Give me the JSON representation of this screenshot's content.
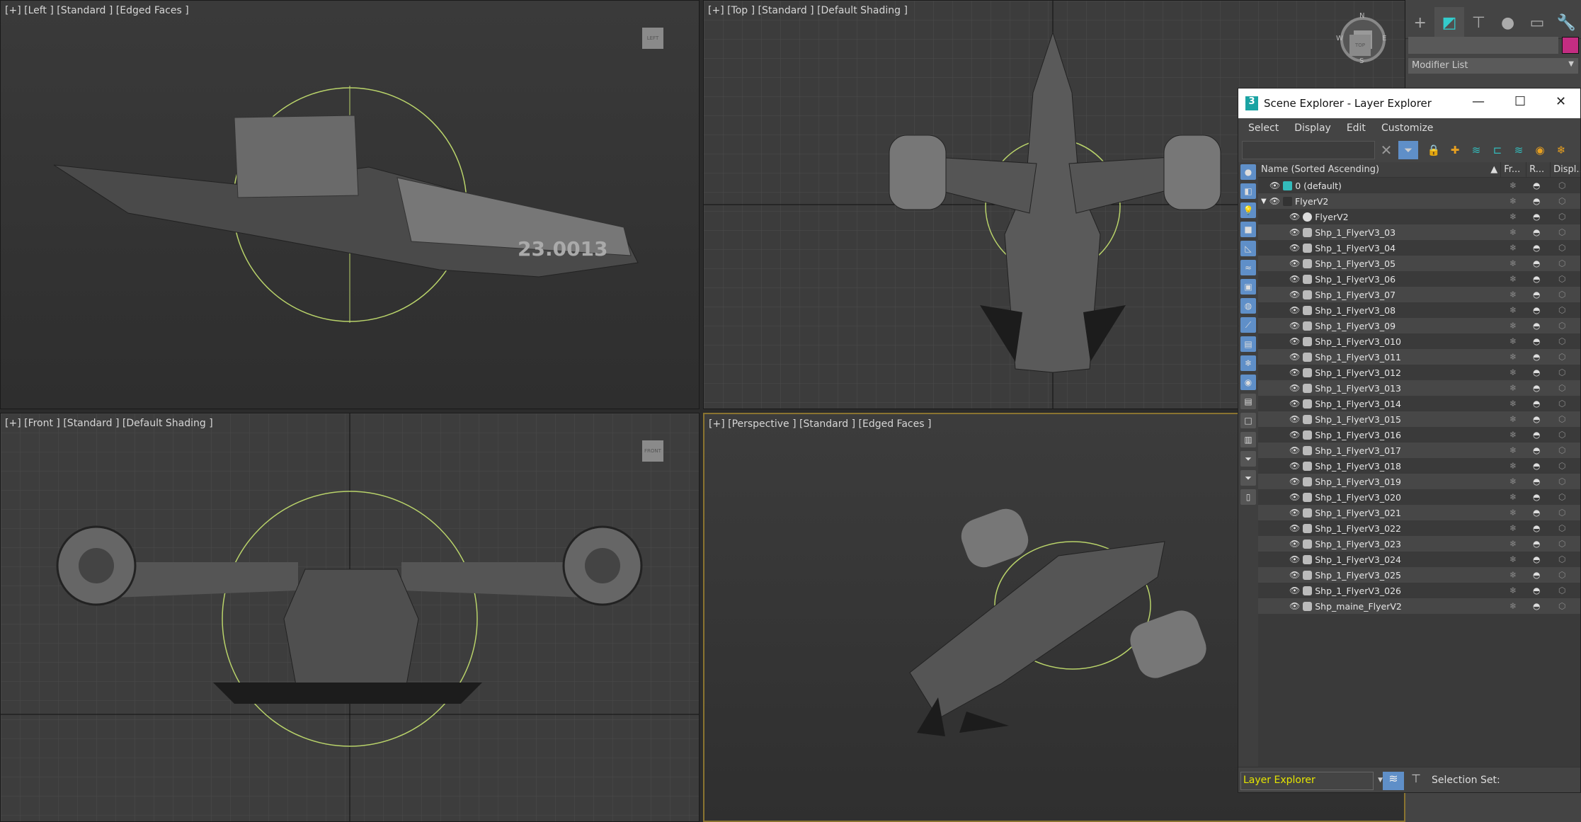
{
  "viewports": {
    "left": {
      "label": "[+] [Left ] [Standard ] [Edged Faces ]",
      "cube": "LEFT"
    },
    "top": {
      "label": "[+] [Top ] [Standard ] [Default Shading ]",
      "cube": "TOP",
      "compass": [
        "N",
        "S",
        "E",
        "W"
      ]
    },
    "front": {
      "label": "[+] [Front ] [Standard ] [Default Shading ]",
      "cube": "FRONT"
    },
    "perspective": {
      "label": "[+] [Perspective ] [Standard ] [Edged Faces ]",
      "active": true
    },
    "ship_decal": "23.0013"
  },
  "command_panel": {
    "tabs": [
      "create",
      "modify",
      "hierarchy",
      "motion",
      "display",
      "utilities"
    ],
    "active_tab": "modify",
    "object_color": "#c42d82",
    "modifier_list": "Modifier List"
  },
  "scene_explorer": {
    "title": "Scene Explorer - Layer Explorer",
    "logo": "3",
    "menu": [
      "Select",
      "Display",
      "Edit",
      "Customize"
    ],
    "search_value": "",
    "columns": [
      "Name (Sorted Ascending)",
      "Fr...",
      "R...",
      "Displ..."
    ],
    "rows": [
      {
        "name": "0 (default)",
        "type": "layer",
        "depth": 0
      },
      {
        "name": "FlyerV2",
        "type": "layer-group",
        "depth": 0,
        "expanded": true
      },
      {
        "name": "FlyerV2",
        "type": "object",
        "depth": 1
      },
      {
        "name": "Shp_1_FlyerV3_03",
        "type": "shape",
        "depth": 1
      },
      {
        "name": "Shp_1_FlyerV3_04",
        "type": "shape",
        "depth": 1
      },
      {
        "name": "Shp_1_FlyerV3_05",
        "type": "shape",
        "depth": 1
      },
      {
        "name": "Shp_1_FlyerV3_06",
        "type": "shape",
        "depth": 1
      },
      {
        "name": "Shp_1_FlyerV3_07",
        "type": "shape",
        "depth": 1
      },
      {
        "name": "Shp_1_FlyerV3_08",
        "type": "shape",
        "depth": 1
      },
      {
        "name": "Shp_1_FlyerV3_09",
        "type": "shape",
        "depth": 1
      },
      {
        "name": "Shp_1_FlyerV3_010",
        "type": "shape",
        "depth": 1
      },
      {
        "name": "Shp_1_FlyerV3_011",
        "type": "shape",
        "depth": 1
      },
      {
        "name": "Shp_1_FlyerV3_012",
        "type": "shape",
        "depth": 1
      },
      {
        "name": "Shp_1_FlyerV3_013",
        "type": "shape",
        "depth": 1
      },
      {
        "name": "Shp_1_FlyerV3_014",
        "type": "shape",
        "depth": 1
      },
      {
        "name": "Shp_1_FlyerV3_015",
        "type": "shape",
        "depth": 1
      },
      {
        "name": "Shp_1_FlyerV3_016",
        "type": "shape",
        "depth": 1
      },
      {
        "name": "Shp_1_FlyerV3_017",
        "type": "shape",
        "depth": 1
      },
      {
        "name": "Shp_1_FlyerV3_018",
        "type": "shape",
        "depth": 1
      },
      {
        "name": "Shp_1_FlyerV3_019",
        "type": "shape",
        "depth": 1
      },
      {
        "name": "Shp_1_FlyerV3_020",
        "type": "shape",
        "depth": 1
      },
      {
        "name": "Shp_1_FlyerV3_021",
        "type": "shape",
        "depth": 1
      },
      {
        "name": "Shp_1_FlyerV3_022",
        "type": "shape",
        "depth": 1
      },
      {
        "name": "Shp_1_FlyerV3_023",
        "type": "shape",
        "depth": 1
      },
      {
        "name": "Shp_1_FlyerV3_024",
        "type": "shape",
        "depth": 1
      },
      {
        "name": "Shp_1_FlyerV3_025",
        "type": "shape",
        "depth": 1
      },
      {
        "name": "Shp_1_FlyerV3_026",
        "type": "shape",
        "depth": 1
      },
      {
        "name": "Shp_maine_FlyerV2",
        "type": "shape",
        "depth": 1
      }
    ],
    "footer": {
      "explorer_select": "Layer Explorer",
      "selection_set_label": "Selection Set:"
    }
  }
}
